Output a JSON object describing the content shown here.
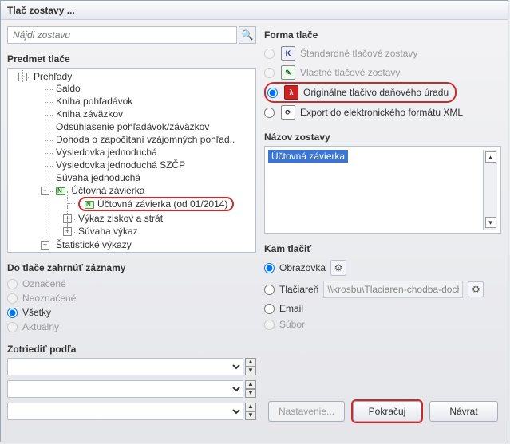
{
  "title": "Tlač zostavy ...",
  "search": {
    "placeholder": "Nájdi zostavu"
  },
  "sections": {
    "subject": "Predmet tlače",
    "include": "Do tlače zahrnúť záznamy",
    "sort": "Zotriediť podľa",
    "form": "Forma tlače",
    "name": "Názov zostavy",
    "dest": "Kam tlačiť"
  },
  "tree": {
    "root": "Prehľady",
    "n1": "Saldo",
    "n2": "Kniha pohľadávok",
    "n3": "Kniha záväzkov",
    "n4": "Odsúhlasenie pohľadávok/záväzkov",
    "n5": "Dohoda o započítaní vzájomných pohľad..",
    "n6": "Výsledovka jednoduchá",
    "n7": "Výsledovka jednoduchá SZČP",
    "n8": "Súvaha jednoduchá",
    "n9": "Účtovná závierka",
    "n9a": "Účtovná závierka (od 01/2014)",
    "n9b": "Výkaz ziskov a strát",
    "n9c": "Súvaha výkaz",
    "n10": "Štatistické výkazy"
  },
  "include": {
    "opt1": "Označené",
    "opt2": "Neoznačené",
    "opt3": "Všetky",
    "opt4": "Aktuálny"
  },
  "form": {
    "opt1": "Štandardné tlačové zostavy",
    "opt2": "Vlastné tlačové zostavy",
    "opt3": "Originálne tlačivo daňového úradu",
    "opt4": "Export do elektronického formátu XML"
  },
  "name_value": "Účtovná závierka",
  "dest": {
    "opt1": "Obrazovka",
    "opt2": "Tlačiareň",
    "opt3": "Email",
    "opt4": "Súbor",
    "printer": "\\\\krosbu\\Tlaciaren-chodba-dochadzk..."
  },
  "buttons": {
    "settings": "Nastavenie...",
    "continue": "Pokračuj",
    "back": "Návrat"
  }
}
